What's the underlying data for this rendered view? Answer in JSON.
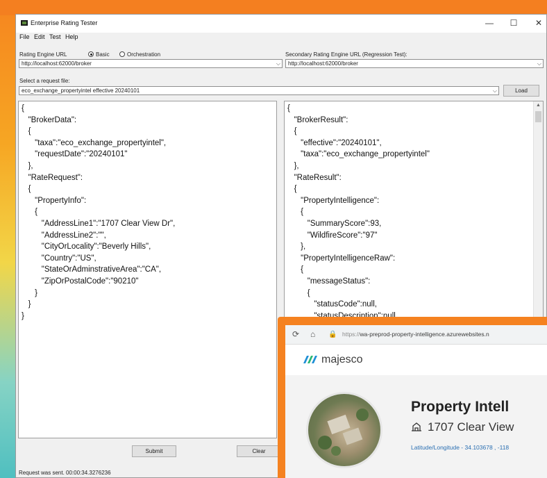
{
  "window": {
    "title": "Enterprise Rating Tester",
    "controls": {
      "minimize": "—",
      "maximize": "☐",
      "close": "✕"
    }
  },
  "menu": [
    "File",
    "Edit",
    "Test",
    "Help"
  ],
  "engine": {
    "label": "Rating Engine URL",
    "mode_basic": "Basic",
    "mode_orchestration": "Orchestration",
    "selected_mode": "Basic",
    "url": "http://localhost:62000/broker"
  },
  "secondary_engine": {
    "label": "Secondary Rating Engine URL (Regression Test):",
    "url": "http://localhost:62000/broker"
  },
  "request_file": {
    "label": "Select a request file:",
    "value": "eco_exchange_propertyintel effective 20240101",
    "load_label": "Load"
  },
  "request_text": "{\n   \"BrokerData\":\n   {\n      \"taxa\":\"eco_exchange_propertyintel\",\n      \"requestDate\":\"20240101\"\n   },\n   \"RateRequest\":\n   {\n      \"PropertyInfo\":\n      {\n         \"AddressLine1\":\"1707 Clear View Dr\",\n         \"AddressLine2\":\"\",\n         \"CityOrLocality\":\"Beverly Hills\",\n         \"Country\":\"US\",\n         \"StateOrAdminstrativeArea\":\"CA\",\n         \"ZipOrPostalCode\":\"90210\"\n      }\n   }\n}",
  "response_text": "{\n   \"BrokerResult\":\n   {\n      \"effective\":\"20240101\",\n      \"taxa\":\"eco_exchange_propertyintel\"\n   },\n   \"RateResult\":\n   {\n      \"PropertyIntelligence\":\n      {\n         \"SummaryScore\":93,\n         \"WildfireScore\":\"97\"\n      },\n      \"PropertyIntelligenceRaw\":\n      {\n         \"messageStatus\":\n         {\n            \"statusCode\":null,\n            \"statusDescription\":null\n         }",
  "buttons": {
    "submit": "Submit",
    "clear": "Clear"
  },
  "status_text": "Request was sent. 00:00:34.3276236",
  "browser": {
    "url_proto": "https://",
    "url_rest": "wa-preprod-property-intelligence.azurewebsites.n",
    "brand": "majesco",
    "property_title": "Property Intell",
    "address": "1707 Clear View",
    "latlon": "Latitude/Longitude - 34.103678 , -118"
  }
}
